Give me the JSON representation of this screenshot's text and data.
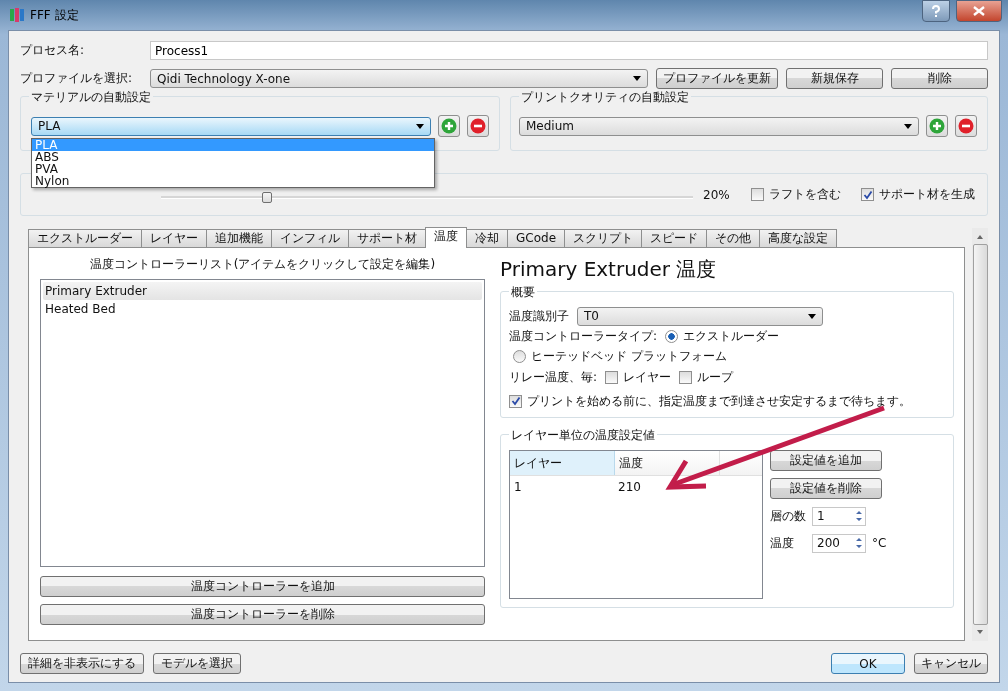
{
  "window": {
    "title": "FFF 設定"
  },
  "process_name": {
    "label": "プロセス名:",
    "value": "Process1"
  },
  "profile": {
    "label": "プロファイルを選択:",
    "value": "Qidi Technology X-one",
    "buttons": [
      "プロファイルを更新",
      "新規保存",
      "削除"
    ]
  },
  "material": {
    "legend": "マテリアルの自動設定",
    "value": "PLA",
    "options": [
      {
        "label": "PLA",
        "selected": true
      },
      {
        "label": "ABS",
        "selected": false
      },
      {
        "label": "PVA",
        "selected": false
      },
      {
        "label": "Nylon",
        "selected": false
      }
    ]
  },
  "quality": {
    "legend": "プリントクオリティの自動設定",
    "value": "Medium"
  },
  "infill": {
    "level": 0.2,
    "reading": "20%"
  },
  "options": [
    {
      "label": "ラフトを含む",
      "checked": false
    },
    {
      "label": "サポート材を生成",
      "checked": true
    }
  ],
  "tabs": [
    {
      "label": "エクストルーダー",
      "selected": false
    },
    {
      "label": "レイヤー",
      "selected": false
    },
    {
      "label": "追加機能",
      "selected": false
    },
    {
      "label": "インフィル",
      "selected": false
    },
    {
      "label": "サポート材",
      "selected": false
    },
    {
      "label": "温度",
      "selected": true
    },
    {
      "label": "冷却",
      "selected": false
    },
    {
      "label": "GCode",
      "selected": false
    },
    {
      "label": "スクリプト",
      "selected": false
    },
    {
      "label": "スピード",
      "selected": false
    },
    {
      "label": "その他",
      "selected": false
    },
    {
      "label": "高度な設定",
      "selected": false
    }
  ],
  "controllers": {
    "heading": "温度コントローラーリスト(アイテムをクリックして設定を編集)",
    "items": [
      {
        "label": "Primary Extruder",
        "selected": true
      },
      {
        "label": "Heated Bed",
        "selected": false
      }
    ],
    "buttons": [
      "温度コントローラーを追加",
      "温度コントローラーを削除"
    ]
  },
  "detail": {
    "title": "Primary Extruder 温度",
    "overview": {
      "legend": "概要",
      "identifier_label": "温度識別子",
      "identifier": "T0",
      "type_label": "温度コントローラータイプ:",
      "types": [
        {
          "label": "エクストルーダー",
          "selected": true
        },
        {
          "label": "ヒーテッドベッド プラットフォーム",
          "selected": false
        }
      ],
      "relay_label": "リレー温度、毎:",
      "relay": [
        {
          "label": "レイヤー",
          "checked": false
        },
        {
          "label": "ループ",
          "checked": false
        }
      ],
      "wait": {
        "label": "プリントを始める前に、指定温度まで到達させ安定するまで待ちます。",
        "checked": true
      }
    },
    "per_layer": {
      "legend": "レイヤー単位の温度設定値",
      "columns": [
        "レイヤー",
        "温度"
      ],
      "rows": [
        [
          "1",
          "210"
        ]
      ],
      "buttons": [
        "設定値を追加",
        "設定値を削除"
      ],
      "layers_label": "層の数",
      "layers": "1",
      "temp_label": "温度",
      "temp": "200",
      "unit": "°C"
    }
  },
  "footer": {
    "left_buttons": [
      "詳細を非表示にする",
      "モデルを選択"
    ],
    "right_buttons": [
      "OK",
      "キャンセル"
    ]
  }
}
